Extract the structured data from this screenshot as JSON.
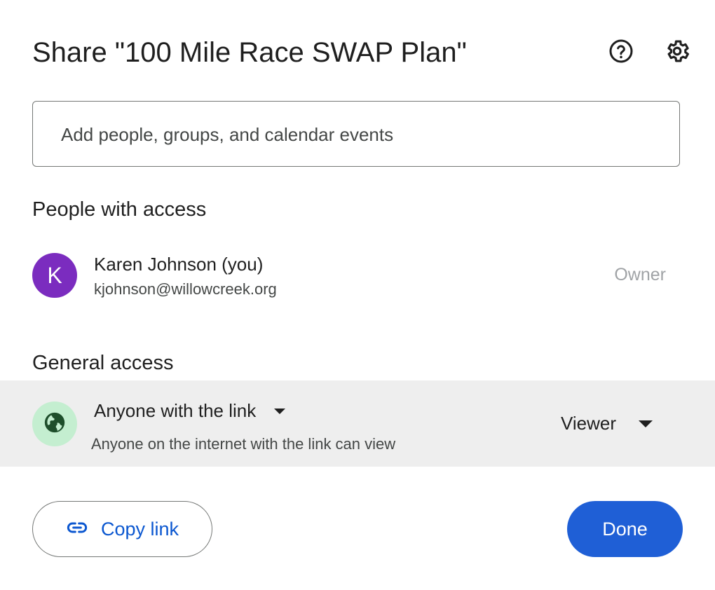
{
  "dialog": {
    "title": "Share \"100 Mile Race SWAP Plan\"",
    "help_icon": "help-circle-icon",
    "settings_icon": "gear-icon"
  },
  "add_people": {
    "placeholder": "Add people, groups, and calendar events",
    "value": ""
  },
  "people_with_access": {
    "heading": "People with access",
    "people": [
      {
        "initial": "K",
        "name": "Karen Johnson (you)",
        "email": "kjohnson@willowcreek.org",
        "role": "Owner",
        "avatar_color": "#7b2cbf"
      }
    ]
  },
  "general_access": {
    "heading": "General access",
    "scope_icon": "globe-icon",
    "scope_label": "Anyone with the link",
    "scope_description": "Anyone on the internet with the link can view",
    "role": "Viewer",
    "row_background": "#eeeeee"
  },
  "footer": {
    "copy_link_icon": "link-icon",
    "copy_link_label": "Copy link",
    "done_label": "Done"
  },
  "colors": {
    "accent": "#0b57d0",
    "done_button": "#1f5fd6",
    "globe_badge": "#c4eed0",
    "globe_icon": "#1e4e2b"
  }
}
